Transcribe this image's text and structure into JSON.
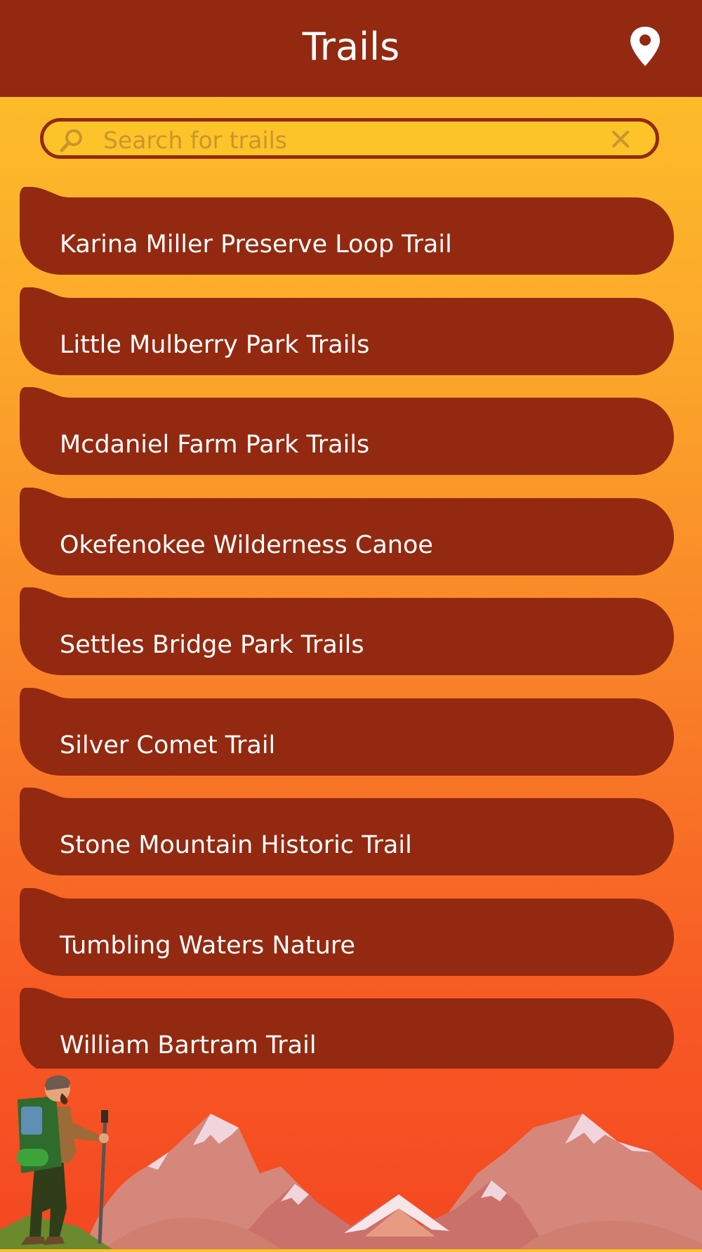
{
  "header": {
    "title": "Trails",
    "location_icon": "map-pin-icon"
  },
  "search": {
    "placeholder": "Search for trails",
    "value": "",
    "search_icon": "magnifier-icon",
    "clear_icon": "close-icon"
  },
  "trails": [
    {
      "name": "Karina Miller Preserve Loop Trail"
    },
    {
      "name": "Little Mulberry Park Trails"
    },
    {
      "name": "Mcdaniel Farm Park Trails"
    },
    {
      "name": "Okefenokee Wilderness Canoe"
    },
    {
      "name": "Settles Bridge Park Trails"
    },
    {
      "name": "Silver Comet Trail"
    },
    {
      "name": "Stone Mountain Historic Trail"
    },
    {
      "name": "Tumbling Waters Nature"
    },
    {
      "name": "William Bartram Trail"
    }
  ],
  "colors": {
    "header_bg": "#932910",
    "item_bg": "#932910",
    "text": "#ffffff",
    "gradient_top": "#fdc42a",
    "gradient_bottom": "#f44722"
  }
}
